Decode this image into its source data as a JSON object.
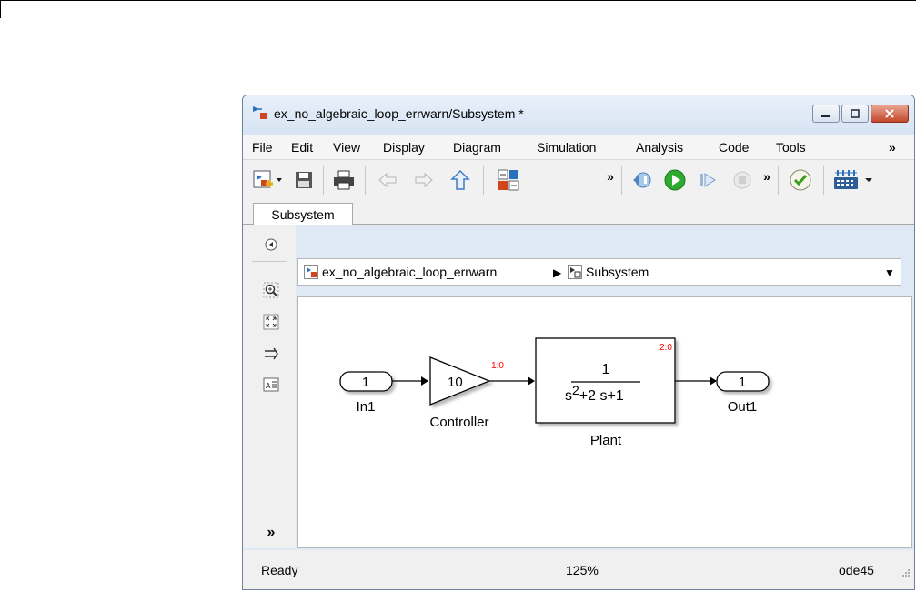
{
  "window": {
    "title": "ex_no_algebraic_loop_errwarn/Subsystem *",
    "buttons": [
      "minimize",
      "restore",
      "close"
    ]
  },
  "menubar": {
    "items": [
      "File",
      "Edit",
      "View",
      "Display",
      "Diagram",
      "Simulation",
      "Analysis",
      "Code",
      "Tools"
    ],
    "overflow": "»"
  },
  "toolbar": {
    "overflow_label": "»",
    "icons": [
      "new-model-icon",
      "save-icon",
      "print-icon",
      "back-arrow-icon",
      "forward-arrow-icon",
      "up-arrow-icon",
      "library-browser-icon",
      "step-back-icon",
      "run-icon",
      "step-forward-icon",
      "stop-icon",
      "check-icon",
      "model-config-icon"
    ]
  },
  "tabs": [
    "Subsystem"
  ],
  "breadcrumb": {
    "root": "ex_no_algebraic_loop_errwarn",
    "separator": "▶",
    "current": "Subsystem",
    "dropdown": "▼"
  },
  "diagram": {
    "in_port": {
      "number": "1",
      "label": "In1"
    },
    "gain": {
      "value": "10",
      "label": "Controller",
      "sample_time": "1:0"
    },
    "plant": {
      "numerator": "1",
      "denominator": "s2+2s+1",
      "den_s": "s",
      "den_exp": "2",
      "den_rest": "+2 s+1",
      "label": "Plant",
      "sample_time": "2:0"
    },
    "out_port": {
      "number": "1",
      "label": "Out1"
    }
  },
  "status": {
    "left": "Ready",
    "zoom": "125%",
    "solver": "ode45"
  },
  "colors": {
    "sample_time": "#ff0000",
    "window_frame": "#dfe9f5"
  }
}
